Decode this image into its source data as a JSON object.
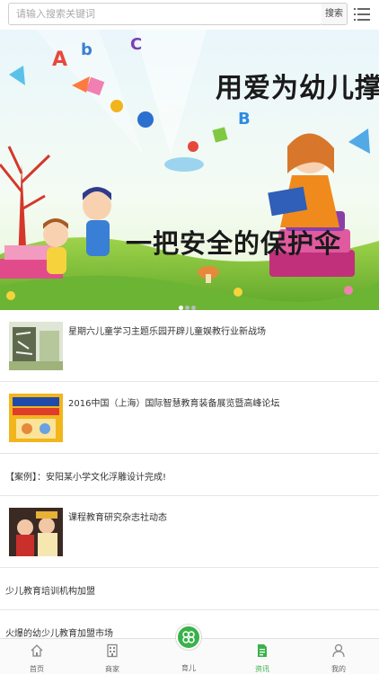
{
  "search": {
    "placeholder": "请输入搜索关键词",
    "button_label": "搜索"
  },
  "banner": {
    "line1": "用爱为幼儿撑起",
    "line2": "一把安全的保护伞",
    "slides": 3,
    "active_slide": 1
  },
  "news": [
    {
      "title": "星期六儿童学习主题乐园开辟儿童娱教行业新战场",
      "has_image": true
    },
    {
      "title": "2016中国（上海）国际智慧教育装备展览暨高峰论坛",
      "has_image": true
    },
    {
      "title": "【案例】：安阳某小学文化浮雕设计完成!",
      "has_image": false
    },
    {
      "title": "课程教育研究杂志社动态",
      "has_image": true
    },
    {
      "title": "少儿教育培训机构加盟",
      "has_image": false
    },
    {
      "title": "火爆的幼少儿教育加盟市场",
      "has_image": false
    }
  ],
  "tabbar": {
    "home": "首页",
    "merchant": "商家",
    "parenting": "育儿",
    "news": "资讯",
    "mine": "我的"
  },
  "colors": {
    "accent": "#38b24a",
    "icon_gray": "#888888"
  }
}
